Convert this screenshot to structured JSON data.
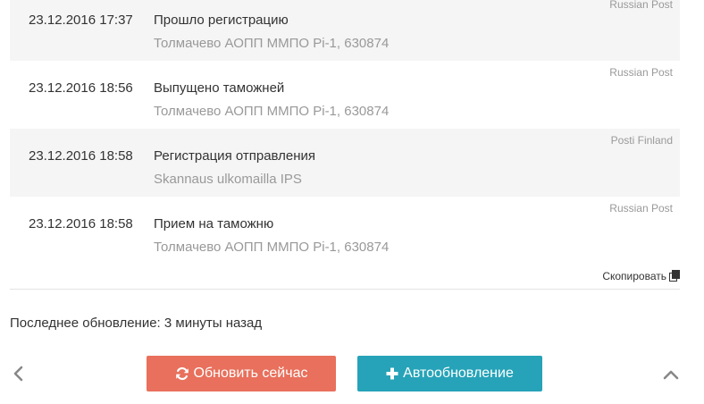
{
  "events": [
    {
      "time": "23.12.2016 17:37",
      "status": "Прошло регистрацию",
      "place": "Толмачево АОПП ММПО Pi-1, 630874",
      "source": "Russian Post"
    },
    {
      "time": "23.12.2016 18:56",
      "status": "Выпущено таможней",
      "place": "Толмачево АОПП ММПО Pi-1, 630874",
      "source": "Russian Post"
    },
    {
      "time": "23.12.2016 18:58",
      "status": "Регистрация отправления",
      "place": "Skannaus ulkomailla IPS",
      "source": "Posti Finland"
    },
    {
      "time": "23.12.2016 18:58",
      "status": "Прием на таможню",
      "place": "Толмачево АОПП ММПО Pi-1, 630874",
      "source": "Russian Post"
    }
  ],
  "copy": {
    "label": "Скопировать",
    "icon": "copy-icon"
  },
  "last_update": "Последнее обновление: 3 минуты назад",
  "buttons": {
    "refresh": {
      "label": "Обновить сейчас",
      "icon": "refresh-icon",
      "color": "#e8705c"
    },
    "auto": {
      "label": "Автообновление",
      "icon": "plus-icon",
      "color": "#26a3b8"
    }
  },
  "nav": {
    "left_icon": "chevron-left-icon",
    "up_icon": "chevron-up-icon"
  }
}
